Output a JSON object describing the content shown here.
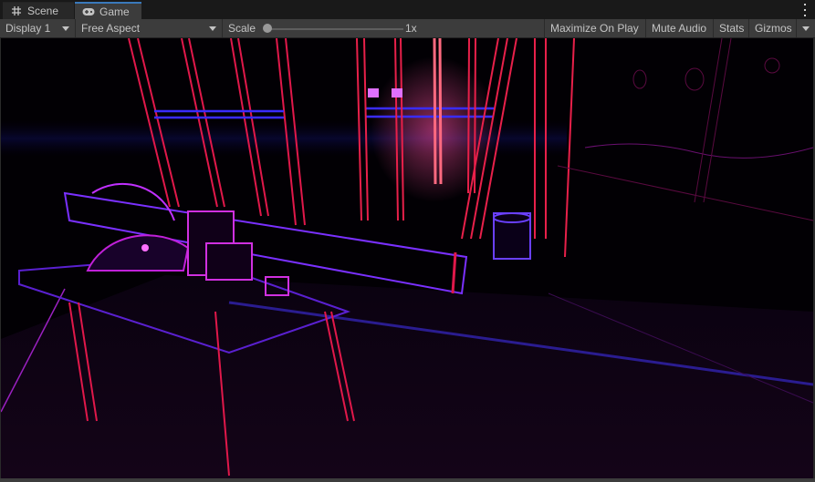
{
  "tabs": [
    {
      "label": "Scene",
      "icon": "grid-hash-icon",
      "active": false
    },
    {
      "label": "Game",
      "icon": "gamepad-icon",
      "active": true
    }
  ],
  "window_menu_icon": "kebab-menu-icon",
  "toolbar": {
    "display": {
      "value": "Display 1",
      "icon": "dropdown-arrow-icon"
    },
    "aspect": {
      "value": "Free Aspect",
      "icon": "dropdown-arrow-icon"
    },
    "scale": {
      "label": "Scale",
      "value": "1x",
      "slider_fraction": 0.0
    },
    "maximize_on_play": "Maximize On Play",
    "mute_audio": "Mute Audio",
    "stats": "Stats",
    "gizmos": "Gizmos",
    "gizmos_menu_icon": "dropdown-arrow-icon"
  },
  "viewport": {
    "description": "Game view render with neon edge-detection post effect: magenta/red vertical trusses, blue horizontal rails, workbench with rail and bowl in foreground",
    "colors": {
      "background": "#020004",
      "edge_red": "#e0184a",
      "edge_magenta": "#d12fd6",
      "edge_blue": "#4a2cff",
      "glow_pink": "#ff4fa0"
    }
  }
}
